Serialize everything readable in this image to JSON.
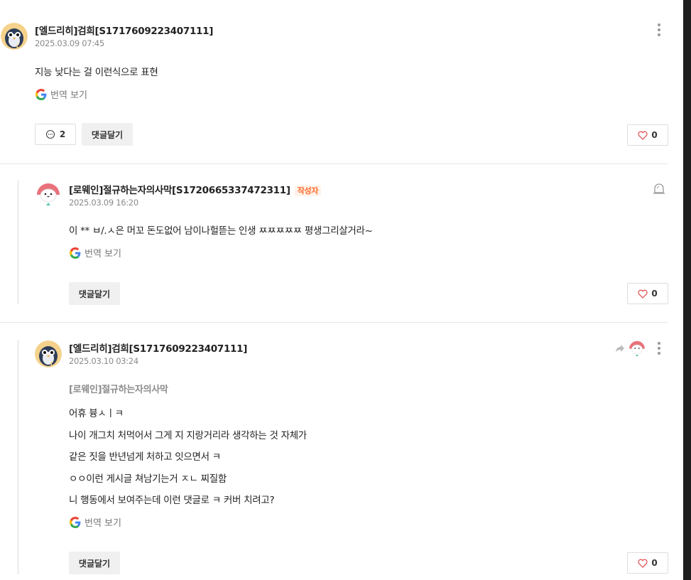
{
  "comments": [
    {
      "author": "[엘드리히]검희[S1717609223407111]",
      "date": "2025.03.09 07:45",
      "lines": [
        "지능 낮다는 걸 이런식으로 표현"
      ],
      "translate_label": "번역 보기",
      "reply_count": "2",
      "reply_button": "댓글달기",
      "like_count": "0"
    },
    {
      "author": "[로웨인]절규하는자의사막[S1720665337472311]",
      "author_badge": "작성자",
      "date": "2025.03.09 16:20",
      "lines": [
        "이 ** ㅂ/.ㅅ은 머꼬 돈도없어 남이나헐뜯는 인생 ㅉㅉㅉㅉㅉ 평생그리살거라~"
      ],
      "translate_label": "번역 보기",
      "reply_button": "댓글달기",
      "like_count": "0"
    },
    {
      "author": "[엘드리히]검희[S1717609223407111]",
      "date": "2025.03.10 03:24",
      "mention": "[로웨인]절규하는자의사막",
      "lines": [
        "어휴 븅ㅅㅣㅋ",
        "나이 개그치 처먹어서 그게 지 지랑거리라 생각하는 것 자체가",
        "같은 짓을 반년넘게 처하고 잇으면서 ㅋ",
        "ㅇㅇ이런 게시글 쳐남기는거 ㅈㄴ 찌질함",
        "니 행동에서 보여주는데 이런 댓글로 ㅋ 커버 치려고?"
      ],
      "translate_label": "번역 보기",
      "reply_button": "댓글달기",
      "like_count": "0"
    }
  ],
  "icons": {
    "translate": "google-g-icon",
    "reply": "speech-bubble-icon",
    "like": "heart-icon",
    "more": "more-vertical-icon",
    "report": "siren-icon",
    "reply_to": "reply-arrow-icon"
  },
  "colors": {
    "badge": "#ff6a2b",
    "like_heart": "#e14b4b",
    "mention": "#8c8c8c"
  }
}
